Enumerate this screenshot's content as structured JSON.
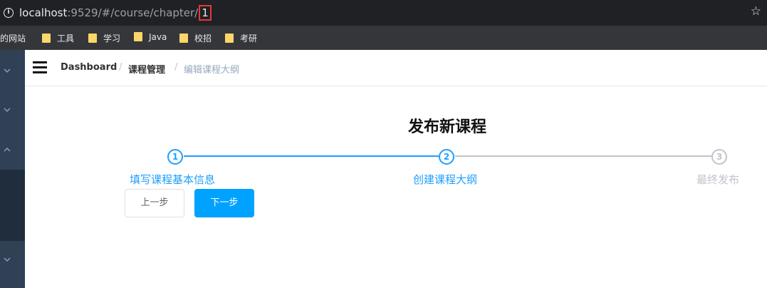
{
  "browser": {
    "url_host": "localhost",
    "url_path": ":9529/#/course/chapter/",
    "url_highlight": "1"
  },
  "bookmarks": [
    {
      "label": "的网站"
    },
    {
      "label": "工具"
    },
    {
      "label": "学习"
    },
    {
      "label": "Java"
    },
    {
      "label": "校招"
    },
    {
      "label": "考研"
    }
  ],
  "breadcrumb": {
    "items": [
      "Dashboard",
      "课程管理",
      "编辑课程大纲"
    ],
    "separator": "/"
  },
  "page": {
    "title": "发布新课程"
  },
  "steps": [
    {
      "number": "1",
      "label": "填写课程基本信息",
      "status": "done"
    },
    {
      "number": "2",
      "label": "创建课程大纲",
      "status": "active"
    },
    {
      "number": "3",
      "label": "最终发布",
      "status": "todo"
    }
  ],
  "buttons": {
    "prev": "上一步",
    "next": "下一步"
  },
  "colors": {
    "accent": "#1e9fff",
    "button_primary": "#00a2ff",
    "sidebar": "#304156",
    "inactive": "#c0c4cc"
  }
}
